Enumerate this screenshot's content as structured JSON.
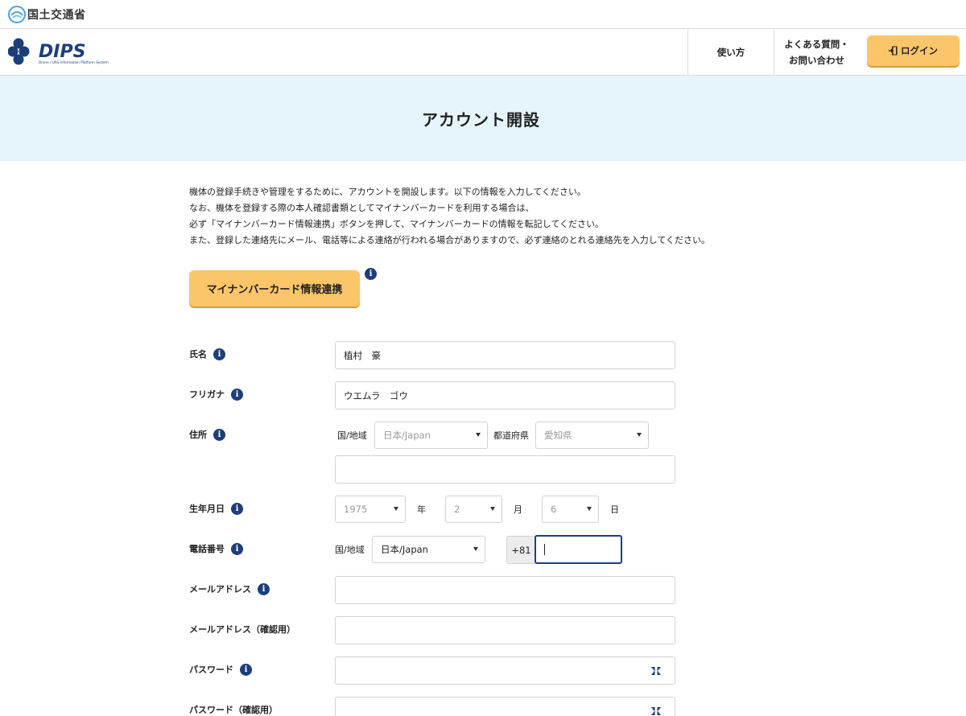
{
  "ministry": {
    "name": "国土交通省"
  },
  "header": {
    "logo_text": "DIPS",
    "logo_subtext": "Drone / UAS Information Platform System",
    "nav": {
      "howto": "使い方",
      "faq_line1": "よくある質問・",
      "faq_line2": "お問い合わせ"
    },
    "login_label": "ログイン"
  },
  "page": {
    "title": "アカウント開設"
  },
  "intro": {
    "line1": "機体の登録手続きや管理をするために、アカウントを開設します。以下の情報を入力してください。",
    "line2": "なお、機体を登録する際の本人確認書類としてマイナンバーカードを利用する場合は、",
    "line3": "必ず「マイナンバーカード情報連携」ボタンを押して、マイナンバーカードの情報を転記してください。",
    "line4": "また、登録した連絡先にメール、電話等による連絡が行われる場合がありますので、必ず連絡のとれる連絡先を入力してください。"
  },
  "mynumber_button": "マイナンバーカード情報連携",
  "form": {
    "name": {
      "label": "氏名",
      "value": "植村　豪"
    },
    "furigana": {
      "label": "フリガナ",
      "value": "ウエムラ　ゴウ"
    },
    "address": {
      "label": "住所",
      "country_label": "国/地域",
      "country_value": "日本/Japan",
      "prefecture_label": "都道府県",
      "prefecture_value": "愛知県",
      "detail_value": ""
    },
    "birthdate": {
      "label": "生年月日",
      "year": "1975",
      "year_unit": "年",
      "month": "2",
      "month_unit": "月",
      "day": "6",
      "day_unit": "日"
    },
    "phone": {
      "label": "電話番号",
      "country_label": "国/地域",
      "country_value": "日本/Japan",
      "prefix": "+81",
      "value": ""
    },
    "email": {
      "label": "メールアドレス",
      "value": ""
    },
    "email_confirm": {
      "label": "メールアドレス（確認用）",
      "value": ""
    },
    "password": {
      "label": "パスワード",
      "value": ""
    },
    "password_confirm": {
      "label": "パスワード（確認用）",
      "value": ""
    }
  },
  "info_icon_glyph": "i",
  "colors": {
    "accent_button": "#fcc56a",
    "title_band": "#e6f4fb",
    "info_icon": "#1c3f7a",
    "logo_blue": "#1c3f7a"
  }
}
